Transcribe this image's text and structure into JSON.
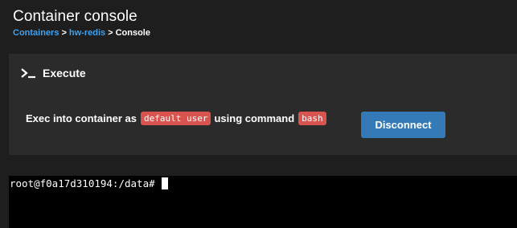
{
  "header": {
    "title": "Container console",
    "breadcrumb": {
      "items": [
        "Containers",
        "hw-redis",
        "Console"
      ],
      "separator": ">"
    }
  },
  "execute_panel": {
    "icon": "terminal-prompt-icon",
    "title": "Execute",
    "exec_text_prefix": "Exec into container as",
    "user_badge": "default user",
    "exec_text_middle": "using command",
    "command_badge": "bash",
    "disconnect_label": "Disconnect"
  },
  "terminal": {
    "prompt": "root@f0a17d310194:/data#"
  },
  "colors": {
    "background": "#1e1e1e",
    "panel": "#2b2b2b",
    "link": "#3ea1f0",
    "badge": "#d9534f",
    "button": "#337ab7",
    "terminal": "#000000"
  }
}
